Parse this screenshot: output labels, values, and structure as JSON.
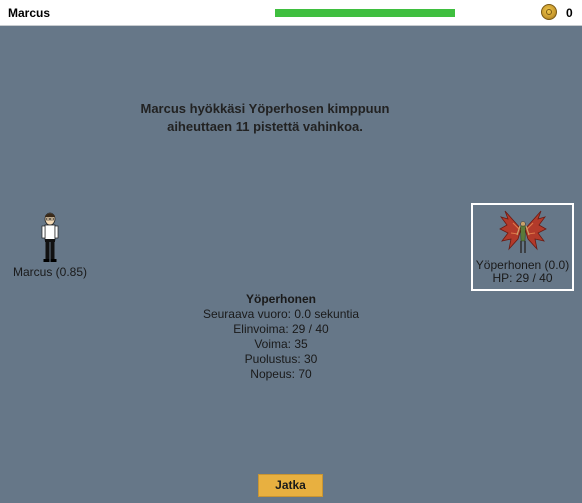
{
  "header": {
    "player_name": "Marcus",
    "hp_fraction": 1.0,
    "hp_color": "#3fbf3f",
    "coin_icon": "gold-coin-icon",
    "coin_count": "0"
  },
  "battle": {
    "message_line1": "Marcus hyökkäsi Yöperhosen kimppuun",
    "message_line2": "aiheuttaen 11 pistettä vahinkoa."
  },
  "player": {
    "label": "Marcus (0.85)"
  },
  "enemy": {
    "label": "Yöperhonen (0.0)",
    "hp_text": "HP: 29 / 40"
  },
  "stats": {
    "name": "Yöperhonen",
    "next_turn": "Seuraava vuoro: 0.0 sekuntia",
    "health": "Elinvoima: 29 / 40",
    "strength": "Voima: 35",
    "defense": "Puolustus: 30",
    "speed": "Nopeus: 70"
  },
  "actions": {
    "continue_label": "Jatka",
    "continue_color": "#e8b040"
  }
}
